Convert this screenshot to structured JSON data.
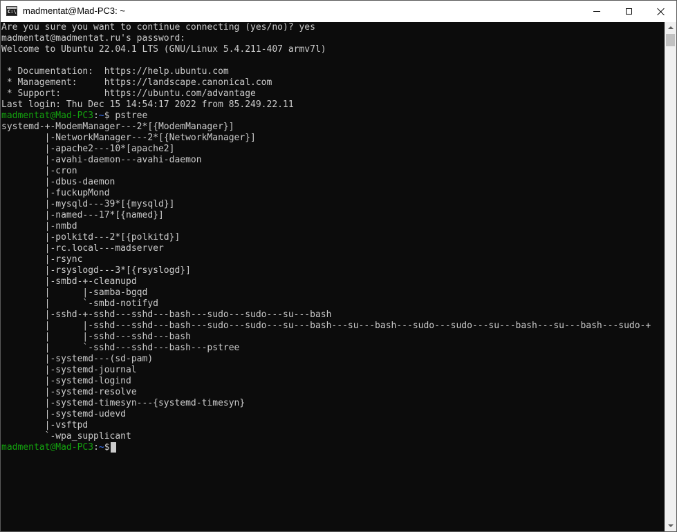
{
  "window": {
    "title": "madmentat@Mad-PC3: ~",
    "icon": "C:\\"
  },
  "scrollbar": {
    "position": 0.0
  },
  "terminal": {
    "lines": [
      {
        "kind": "text",
        "text": "Are you sure you want to continue connecting (yes/no)? yes"
      },
      {
        "kind": "text",
        "text": "madmentat@madmentat.ru's password:"
      },
      {
        "kind": "text",
        "text": "Welcome to Ubuntu 22.04.1 LTS (GNU/Linux 5.4.211-407 armv7l)"
      },
      {
        "kind": "text",
        "text": ""
      },
      {
        "kind": "text",
        "text": " * Documentation:  https://help.ubuntu.com"
      },
      {
        "kind": "text",
        "text": " * Management:     https://landscape.canonical.com"
      },
      {
        "kind": "text",
        "text": " * Support:        https://ubuntu.com/advantage"
      },
      {
        "kind": "text",
        "text": "Last login: Thu Dec 15 14:54:17 2022 from 85.249.22.11"
      },
      {
        "kind": "prompt",
        "user": "madmentat@Mad-PC3",
        "sep": ":",
        "path": "~",
        "sym": "$ ",
        "cmd": "pstree"
      },
      {
        "kind": "text",
        "text": "systemd-+-ModemManager---2*[{ModemManager}]"
      },
      {
        "kind": "text",
        "text": "        |-NetworkManager---2*[{NetworkManager}]"
      },
      {
        "kind": "text",
        "text": "        |-apache2---10*[apache2]"
      },
      {
        "kind": "text",
        "text": "        |-avahi-daemon---avahi-daemon"
      },
      {
        "kind": "text",
        "text": "        |-cron"
      },
      {
        "kind": "text",
        "text": "        |-dbus-daemon"
      },
      {
        "kind": "text",
        "text": "        |-fuckupMond"
      },
      {
        "kind": "text",
        "text": "        |-mysqld---39*[{mysqld}]"
      },
      {
        "kind": "text",
        "text": "        |-named---17*[{named}]"
      },
      {
        "kind": "text",
        "text": "        |-nmbd"
      },
      {
        "kind": "text",
        "text": "        |-polkitd---2*[{polkitd}]"
      },
      {
        "kind": "text",
        "text": "        |-rc.local---madserver"
      },
      {
        "kind": "text",
        "text": "        |-rsync"
      },
      {
        "kind": "text",
        "text": "        |-rsyslogd---3*[{rsyslogd}]"
      },
      {
        "kind": "text",
        "text": "        |-smbd-+-cleanupd"
      },
      {
        "kind": "text",
        "text": "        |      |-samba-bgqd"
      },
      {
        "kind": "text",
        "text": "        |      `-smbd-notifyd"
      },
      {
        "kind": "text",
        "text": "        |-sshd-+-sshd---sshd---bash---sudo---sudo---su---bash"
      },
      {
        "kind": "text",
        "text": "        |      |-sshd---sshd---bash---sudo---sudo---su---bash---su---bash---sudo---sudo---su---bash---su---bash---sudo-+"
      },
      {
        "kind": "text",
        "text": "        |      |-sshd---sshd---bash"
      },
      {
        "kind": "text",
        "text": "        |      `-sshd---sshd---bash---pstree"
      },
      {
        "kind": "text",
        "text": "        |-systemd---(sd-pam)"
      },
      {
        "kind": "text",
        "text": "        |-systemd-journal"
      },
      {
        "kind": "text",
        "text": "        |-systemd-logind"
      },
      {
        "kind": "text",
        "text": "        |-systemd-resolve"
      },
      {
        "kind": "text",
        "text": "        |-systemd-timesyn---{systemd-timesyn}"
      },
      {
        "kind": "text",
        "text": "        |-systemd-udevd"
      },
      {
        "kind": "text",
        "text": "        |-vsftpd"
      },
      {
        "kind": "text",
        "text": "        `-wpa_supplicant"
      },
      {
        "kind": "prompt",
        "user": "madmentat@Mad-PC3",
        "sep": ":",
        "path": "~",
        "sym": "$",
        "cmd": "",
        "cursor": true
      }
    ]
  }
}
